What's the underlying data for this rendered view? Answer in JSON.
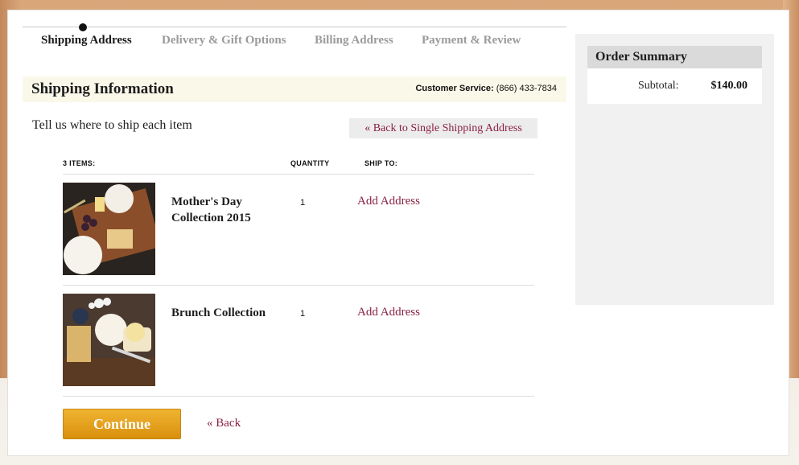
{
  "steps": [
    {
      "label": "Shipping Address",
      "active": true
    },
    {
      "label": "Delivery & Gift Options",
      "active": false
    },
    {
      "label": "Billing Address",
      "active": false
    },
    {
      "label": "Payment & Review",
      "active": false
    }
  ],
  "section": {
    "title": "Shipping Information",
    "customer_service_label": "Customer Service:",
    "customer_service_phone": "(866) 433-7834"
  },
  "intro_text": "Tell us where to ship each item",
  "back_single_label": "« Back to Single Shipping Address",
  "table": {
    "col_items": "3 ITEMS:",
    "col_quantity": "QUANTITY",
    "col_ship_to": "SHIP TO:"
  },
  "items": [
    {
      "name": "Mother's Day Collection 2015",
      "quantity": "1",
      "ship_to_label": "Add Address"
    },
    {
      "name": "Brunch Collection",
      "quantity": "1",
      "ship_to_label": "Add Address"
    }
  ],
  "continue_label": "Continue",
  "back_label": "« Back",
  "summary": {
    "title": "Order Summary",
    "subtotal_label": "Subtotal:",
    "subtotal_value": "$140.00"
  },
  "colors": {
    "accent": "#8a2140",
    "button": "#e6a21f"
  }
}
